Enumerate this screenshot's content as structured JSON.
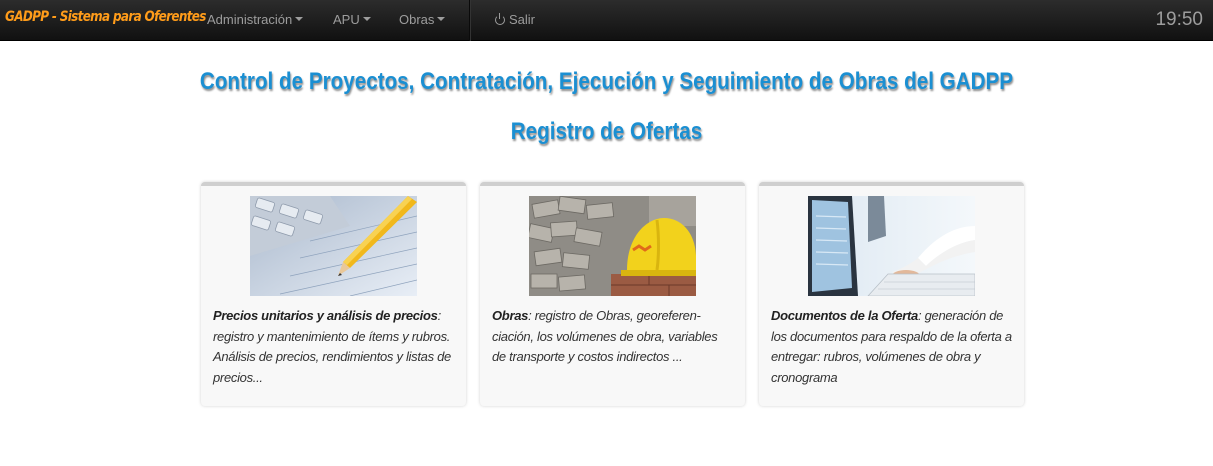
{
  "navbar": {
    "brand": "GADPP - Sistema para Oferentes",
    "menus": [
      {
        "label": "Administración"
      },
      {
        "label": "APU"
      },
      {
        "label": "Obras"
      }
    ],
    "logout_label": "Salir",
    "clock": "19:50",
    "brand_color": "#ff9c1a"
  },
  "header": {
    "title": "Control de Proyectos, Contratación, Ejecución y Seguimiento de Obras del GADPP",
    "subtitle": "Registro de Ofertas",
    "accent_color": "#1b8fd2"
  },
  "cards": [
    {
      "image": "calculator-pencil-photo",
      "heading": "Precios unitarios y análisis de precios",
      "body": ": registro y mantenimiento de ítems y rubros. Análisis de precios, rendimientos y listas de precios..."
    },
    {
      "image": "hardhat-construction-photo",
      "heading": "Obras",
      "body": ": registro de Obras, georeferen-ciación, los volúmenes de obra, variables de transporte y costos indirectos ..."
    },
    {
      "image": "computer-keyboard-photo",
      "heading": "Documentos de la Oferta",
      "body": ": generación de los documentos para respaldo de la oferta a entregar: rubros, volúmenes de obra y cronograma"
    }
  ]
}
